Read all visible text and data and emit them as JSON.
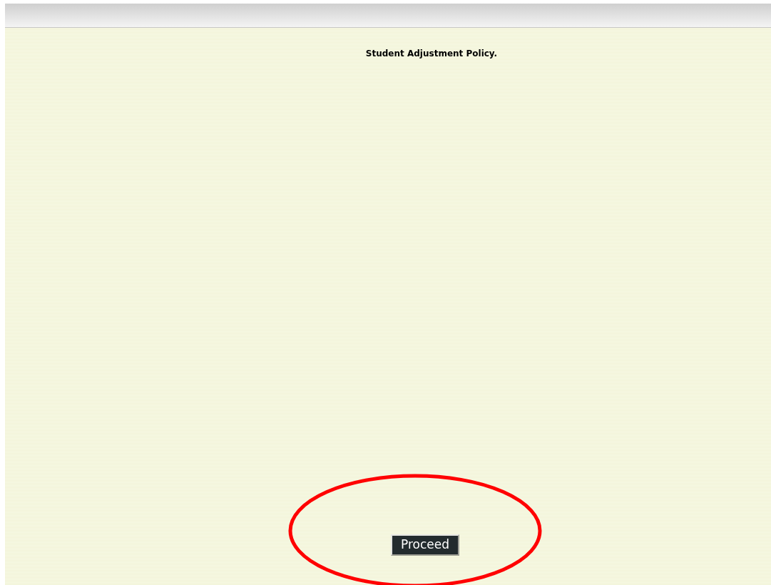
{
  "page": {
    "title": "Student Adjustment Policy."
  },
  "proceed_button": {
    "label": "Proceed"
  },
  "annotation": {
    "kind": "ellipse"
  }
}
